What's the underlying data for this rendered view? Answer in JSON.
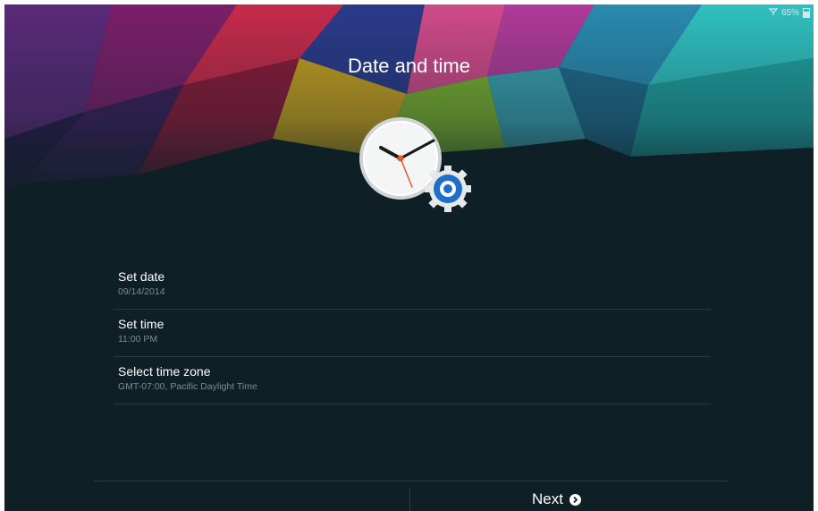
{
  "status_bar": {
    "battery_percent": "65%",
    "icons": [
      "signal-icon",
      "battery-icon"
    ]
  },
  "header": {
    "title": "Date and time"
  },
  "settings": {
    "items": [
      {
        "label": "Set date",
        "value": "09/14/2014"
      },
      {
        "label": "Set time",
        "value": "11:00 PM"
      },
      {
        "label": "Select time zone",
        "value": "GMT-07:00, Pacific Daylight Time"
      }
    ]
  },
  "footer": {
    "next_label": "Next",
    "next_icon": "chevron-right-circle-icon"
  },
  "colors": {
    "background": "#0f1f26",
    "text_primary": "#ffffff",
    "text_secondary": "#7d8c93",
    "accent_blue": "#1f6fc9"
  }
}
